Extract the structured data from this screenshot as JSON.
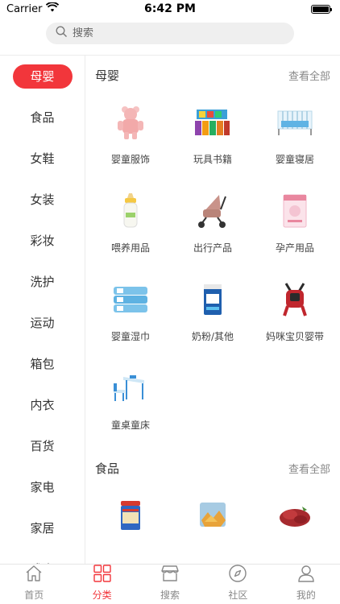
{
  "status": {
    "carrier": "Carrier",
    "time": "6:42 PM"
  },
  "search": {
    "placeholder": "搜索"
  },
  "sidebar": {
    "items": [
      {
        "label": "母婴",
        "active": true
      },
      {
        "label": "食品"
      },
      {
        "label": "女鞋"
      },
      {
        "label": "女装"
      },
      {
        "label": "彩妆"
      },
      {
        "label": "洗护"
      },
      {
        "label": "运动"
      },
      {
        "label": "箱包"
      },
      {
        "label": "内衣"
      },
      {
        "label": "百货"
      },
      {
        "label": "家电"
      },
      {
        "label": "家居"
      },
      {
        "label": "成人"
      }
    ]
  },
  "sections": [
    {
      "title": "母婴",
      "see_all": "查看全部",
      "items": [
        {
          "label": "婴童服饰",
          "icon": "baby-clothes-icon"
        },
        {
          "label": "玩具书籍",
          "icon": "toy-books-icon"
        },
        {
          "label": "婴童寝居",
          "icon": "baby-crib-icon"
        },
        {
          "label": "喂养用品",
          "icon": "baby-bottle-icon"
        },
        {
          "label": "出行产品",
          "icon": "stroller-icon"
        },
        {
          "label": "孕产用品",
          "icon": "maternity-pack-icon"
        },
        {
          "label": "婴童湿巾",
          "icon": "wet-wipes-icon"
        },
        {
          "label": "奶粉/其他",
          "icon": "milk-powder-icon"
        },
        {
          "label": "妈咪宝贝婴带",
          "icon": "baby-carrier-icon"
        },
        {
          "label": "童桌童床",
          "icon": "kids-desk-icon"
        }
      ]
    },
    {
      "title": "食品",
      "see_all": "查看全部",
      "items": [
        {
          "label": "",
          "icon": "oatmeal-can-icon"
        },
        {
          "label": "",
          "icon": "snack-chips-icon"
        },
        {
          "label": "",
          "icon": "dried-meat-icon"
        }
      ]
    }
  ],
  "tabbar": {
    "items": [
      {
        "label": "首页",
        "icon": "home-icon"
      },
      {
        "label": "分类",
        "icon": "category-icon",
        "active": true
      },
      {
        "label": "搜索",
        "icon": "store-icon"
      },
      {
        "label": "社区",
        "icon": "compass-icon"
      },
      {
        "label": "我的",
        "icon": "profile-icon"
      }
    ]
  },
  "colors": {
    "accent": "#f2363b",
    "muted": "#888888",
    "search_bg": "#efefef"
  }
}
